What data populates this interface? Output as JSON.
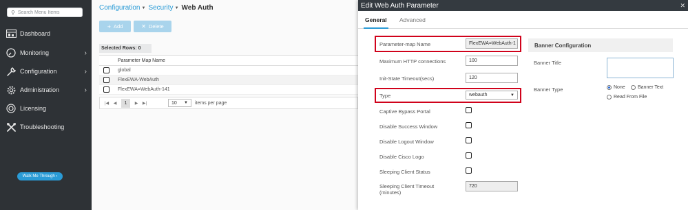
{
  "sidebar": {
    "search_placeholder": "Search Menu Items",
    "items": [
      {
        "label": "Dashboard",
        "icon": "dashboard-icon",
        "chevron": ""
      },
      {
        "label": "Monitoring",
        "icon": "monitoring-icon",
        "chevron": "›"
      },
      {
        "label": "Configuration",
        "icon": "wrench-icon",
        "chevron": "›"
      },
      {
        "label": "Administration",
        "icon": "gear-icon",
        "chevron": "›"
      },
      {
        "label": "Licensing",
        "icon": "licensing-icon",
        "chevron": ""
      },
      {
        "label": "Troubleshooting",
        "icon": "tools-icon",
        "chevron": ""
      }
    ],
    "walk_me_through": "Walk Me Through ›"
  },
  "breadcrumb": {
    "configuration": "Configuration",
    "security": "Security",
    "current": "Web Auth"
  },
  "toolbar": {
    "add_label": "Add",
    "delete_label": "Delete"
  },
  "selected_rows": "Selected Rows: 0",
  "table": {
    "column_header": "Parameter Map Name",
    "rows": [
      "global",
      "FlexEWA-WebAuth",
      "FlexEWA=WebAuth-141"
    ]
  },
  "pager": {
    "current_page": "1",
    "page_size": "10",
    "items_per_page_label": "items per page"
  },
  "panel": {
    "title": "Edit Web Auth Parameter",
    "tabs": {
      "general": "General",
      "advanced": "Advanced"
    },
    "fields": {
      "param_map_name_label": "Parameter-map Name",
      "param_map_name_value": "FlexEWA=WebAuth-1",
      "max_http_label": "Maximum HTTP connections",
      "max_http_value": "100",
      "init_state_label": "Init-State Timeout(secs)",
      "init_state_value": "120",
      "type_label": "Type",
      "type_value": "webauth",
      "captive_bypass_label": "Captive Bypass Portal",
      "disable_success_label": "Disable Success Window",
      "disable_logout_label": "Disable Logout Window",
      "disable_cisco_logo_label": "Disable Cisco Logo",
      "sleeping_status_label": "Sleeping Client Status",
      "sleeping_timeout_label_1": "Sleeping Client Timeout",
      "sleeping_timeout_label_2": "(minutes)",
      "sleeping_timeout_value": "720"
    },
    "banner": {
      "heading": "Banner Configuration",
      "title_label": "Banner Title",
      "type_label": "Banner Type",
      "opt_none": "None",
      "opt_banner_text": "Banner Text",
      "opt_read_from_file": "Read From File",
      "selected": "None"
    }
  },
  "colors": {
    "accent": "#2a9bd6",
    "sidebar_bg": "#2e3236",
    "highlight_red": "#d0021b",
    "panel_header": "#343a40"
  }
}
